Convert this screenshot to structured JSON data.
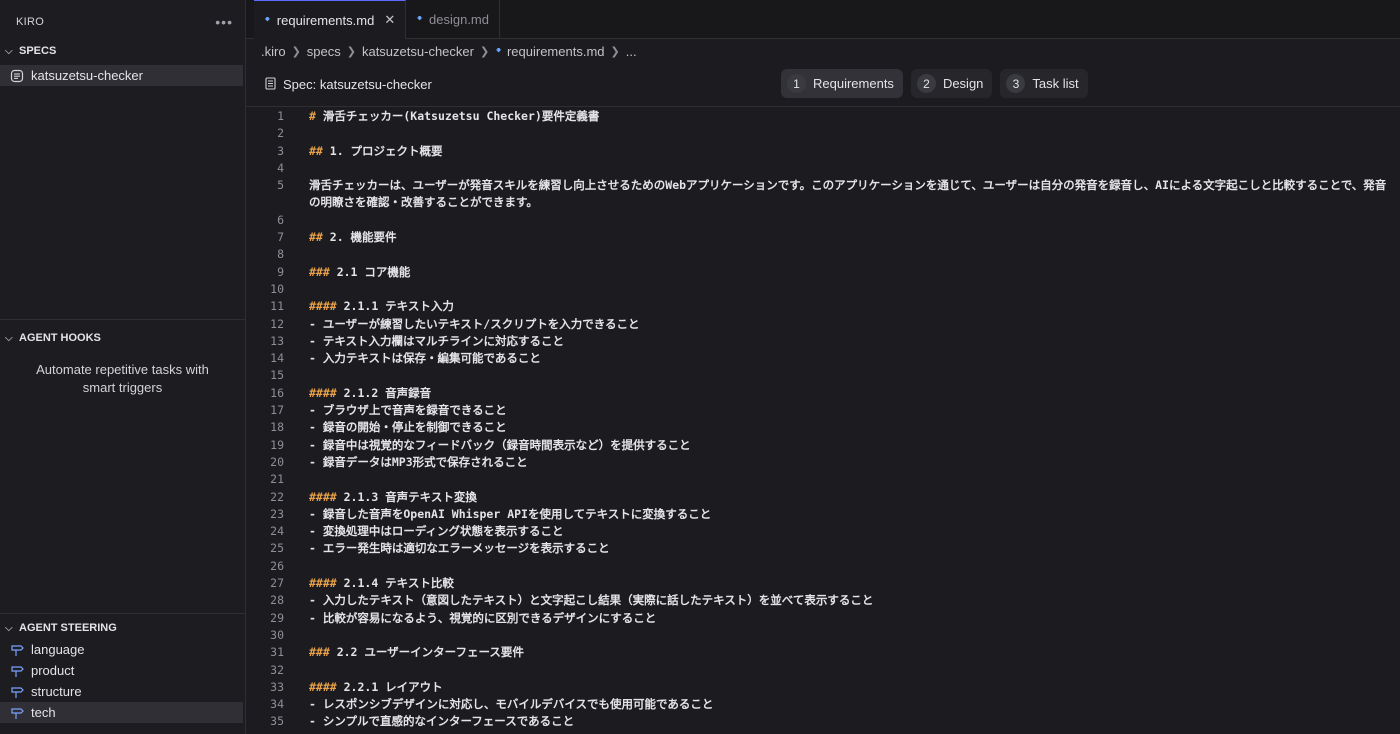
{
  "sidebar": {
    "title": "KIRO",
    "more": "•••",
    "specs": {
      "heading": "SPECS",
      "items": [
        {
          "label": "katsuzetsu-checker"
        }
      ]
    },
    "hooks": {
      "heading": "AGENT HOOKS",
      "description": "Automate repetitive tasks with smart triggers"
    },
    "steering": {
      "heading": "AGENT STEERING",
      "items": [
        {
          "label": "language"
        },
        {
          "label": "product"
        },
        {
          "label": "structure"
        },
        {
          "label": "tech"
        }
      ]
    }
  },
  "tabs": [
    {
      "label": "requirements.md",
      "close": "✕"
    },
    {
      "label": "design.md"
    }
  ],
  "breadcrumb": {
    "items": [
      ".kiro",
      "specs",
      "katsuzetsu-checker",
      "requirements.md",
      "..."
    ]
  },
  "spec": {
    "title": "Spec: katsuzetsu-checker",
    "steps": [
      {
        "num": "1",
        "label": "Requirements"
      },
      {
        "num": "2",
        "label": "Design"
      },
      {
        "num": "3",
        "label": "Task list"
      }
    ]
  },
  "editor": {
    "lines": [
      {
        "n": "1",
        "h": "#",
        "t": " 滑舌チェッカー(Katsuzetsu Checker)要件定義書"
      },
      {
        "n": "2",
        "h": "",
        "t": ""
      },
      {
        "n": "3",
        "h": "##",
        "t": " 1. プロジェクト概要"
      },
      {
        "n": "4",
        "h": "",
        "t": ""
      },
      {
        "n": "5",
        "h": "",
        "t": "滑舌チェッカーは、ユーザーが発音スキルを練習し向上させるためのWebアプリケーションです。このアプリケーションを通じて、ユーザーは自分の発音を録音し、AIによる文字起こしと比較することで、発音の明瞭さを確認・改善することができます。"
      },
      {
        "n": "6",
        "h": "",
        "t": ""
      },
      {
        "n": "7",
        "h": "##",
        "t": " 2. 機能要件"
      },
      {
        "n": "8",
        "h": "",
        "t": ""
      },
      {
        "n": "9",
        "h": "###",
        "t": " 2.1 コア機能"
      },
      {
        "n": "10",
        "h": "",
        "t": ""
      },
      {
        "n": "11",
        "h": "####",
        "t": " 2.1.1 テキスト入力"
      },
      {
        "n": "12",
        "h": "",
        "t": "- ユーザーが練習したいテキスト/スクリプトを入力できること"
      },
      {
        "n": "13",
        "h": "",
        "t": "- テキスト入力欄はマルチラインに対応すること"
      },
      {
        "n": "14",
        "h": "",
        "t": "- 入力テキストは保存・編集可能であること"
      },
      {
        "n": "15",
        "h": "",
        "t": ""
      },
      {
        "n": "16",
        "h": "####",
        "t": " 2.1.2 音声録音"
      },
      {
        "n": "17",
        "h": "",
        "t": "- ブラウザ上で音声を録音できること"
      },
      {
        "n": "18",
        "h": "",
        "t": "- 録音の開始・停止を制御できること"
      },
      {
        "n": "19",
        "h": "",
        "t": "- 録音中は視覚的なフィードバック（録音時間表示など）を提供すること"
      },
      {
        "n": "20",
        "h": "",
        "t": "- 録音データはMP3形式で保存されること"
      },
      {
        "n": "21",
        "h": "",
        "t": ""
      },
      {
        "n": "22",
        "h": "####",
        "t": " 2.1.3 音声テキスト変換"
      },
      {
        "n": "23",
        "h": "",
        "t": "- 録音した音声をOpenAI Whisper APIを使用してテキストに変換すること"
      },
      {
        "n": "24",
        "h": "",
        "t": "- 変換処理中はローディング状態を表示すること"
      },
      {
        "n": "25",
        "h": "",
        "t": "- エラー発生時は適切なエラーメッセージを表示すること"
      },
      {
        "n": "26",
        "h": "",
        "t": ""
      },
      {
        "n": "27",
        "h": "####",
        "t": " 2.1.4 テキスト比較"
      },
      {
        "n": "28",
        "h": "",
        "t": "- 入力したテキスト（意図したテキスト）と文字起こし結果（実際に話したテキスト）を並べて表示すること"
      },
      {
        "n": "29",
        "h": "",
        "t": "- 比較が容易になるよう、視覚的に区別できるデザインにすること"
      },
      {
        "n": "30",
        "h": "",
        "t": ""
      },
      {
        "n": "31",
        "h": "###",
        "t": " 2.2 ユーザーインターフェース要件"
      },
      {
        "n": "32",
        "h": "",
        "t": ""
      },
      {
        "n": "33",
        "h": "####",
        "t": " 2.2.1 レイアウト"
      },
      {
        "n": "34",
        "h": "",
        "t": "- レスポンシブデザインに対応し、モバイルデバイスでも使用可能であること"
      },
      {
        "n": "35",
        "h": "",
        "t": "- シンプルで直感的なインターフェースであること"
      }
    ]
  }
}
